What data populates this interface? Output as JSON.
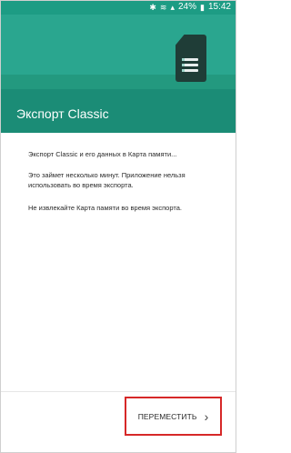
{
  "status_bar": {
    "battery_percent": "24%",
    "time": "15:42"
  },
  "header": {
    "title": "Экспорт Classic"
  },
  "content": {
    "line1": "Экспорт Classic и его данных в Карта памяти...",
    "line2": "Это займет несколько минут. Приложение нельзя использовать во время экспорта.",
    "line3": "Не извлекайте Карта памяти во время экспорта."
  },
  "actions": {
    "move_label": "ПЕРЕМЕСТИТЬ",
    "move_icon": "chevron-right-icon"
  },
  "colors": {
    "accent": "#2aa68f",
    "highlight_border": "#d62828"
  }
}
